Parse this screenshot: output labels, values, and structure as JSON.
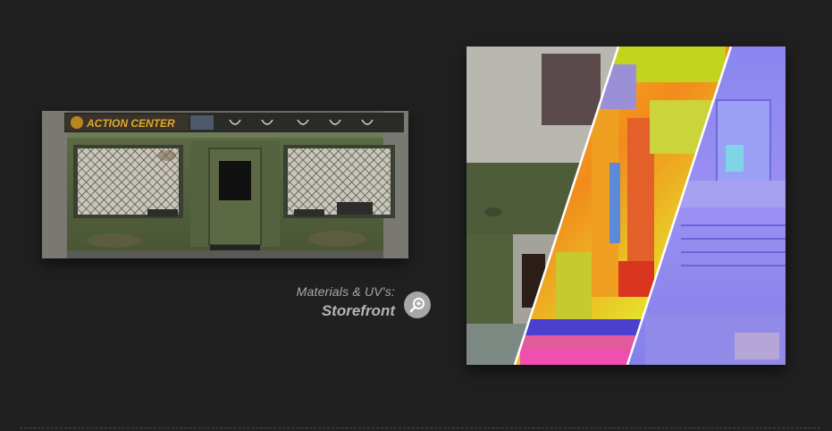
{
  "storefront_render": {
    "sign_text": "ACTION CENTER"
  },
  "caption": {
    "subtitle": "Materials & UV's:",
    "title": "Storefront"
  },
  "zoom_button": {
    "icon": "zoom-in-icon"
  },
  "texture_sheet": {
    "sections": [
      "diffuse",
      "material-id",
      "normal"
    ]
  }
}
